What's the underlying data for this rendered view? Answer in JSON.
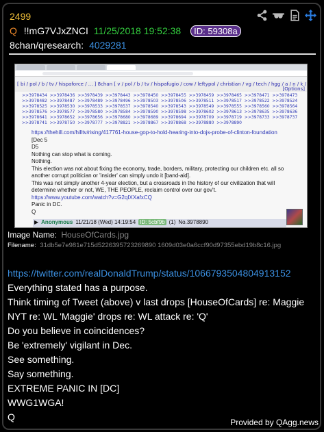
{
  "post": {
    "number": "2499",
    "q_mark": "Q",
    "tripcode": "!!mG7VJxZNCI",
    "datetime": "11/25/2018 19:52:38",
    "id_badge": "ID: 59308a",
    "board_label": "8chan/qresearch:",
    "board_link": "4029281"
  },
  "actions": {
    "icons": [
      "share-icon",
      "glasses-icon",
      "document-icon",
      "move-icon"
    ]
  },
  "screenshot": {
    "nav_line1": "[ bi / pol / b / tv / hispaforce / ... ] 8chan [ v / pol / b / tv / hispafugio / cow / leftypol / christian / vg / tech / hgg / a / n / k / fk / arepa / leftpol / tg / co / animu / brit / asmr / vichan / newsplus / egy ] [ watchlist ]",
    "nav_options": "[Options]",
    "link_rows": [
      [
        ">>3978434",
        ">>3978436",
        ">>3978439",
        ">>3978443",
        ">>3978450",
        ">>3978455",
        ">>3978459",
        ">>3978465",
        ">>3978471",
        ">>3978473"
      ],
      [
        ">>3978482",
        ">>3978487",
        ">>3978489",
        ">>3978496",
        ">>3978503",
        ">>3978506",
        ">>3978511",
        ">>3978517",
        ">>3978522",
        ">>3978524"
      ],
      [
        ">>3978525",
        ">>3978530",
        ">>3978533",
        ">>3978537",
        ">>3978540",
        ">>3978543",
        ">>3978549",
        ">>3978555",
        ">>3978560",
        ">>3978564"
      ],
      [
        ">>3978576",
        ">>3978577",
        ">>3978580",
        ">>3978584",
        ">>3978590",
        ">>3978598",
        ">>3978602",
        ">>3978613",
        ">>3978635",
        ">>3978636"
      ],
      [
        ">>3978641",
        ">>3978652",
        ">>3978656",
        ">>3978680",
        ">>3978689",
        ">>3978694",
        ">>3978709",
        ">>3978719",
        ">>3978733",
        ">>3978737"
      ],
      [
        ">>3978741",
        ">>3978750",
        ">>3978777",
        ">>3978821",
        ">>3978867",
        ">>3978868",
        ">>3978880",
        ">>3978890",
        "",
        ""
      ]
    ],
    "text_lines": [
      "https://thehill.com/hilltv/rising/417761-house-gop-to-hold-hearing-into-dojs-probe-of-clinton-foundation",
      "[Dec 5",
      "D5",
      "Nothing can stop what is coming.",
      "Nothing.",
      "This election was not about fixing the economy, trade, borders, military, protecting our children etc. all so",
      "another corrupt politician or 'insider' can simply undo it [band-aid].",
      "This was not simply another 4-year election, but a crossroads in the history of our civilization that will",
      "determine whether or not, WE, THE PEOPLE, reclaim control over our gov't.",
      "https://www.youtube.com/watch?v=G2qIXXafxCQ",
      "Panic in DC.",
      "Q"
    ],
    "footer_name": "Anonymous",
    "footer_date": "11/21/18 (Wed) 14:19:54",
    "footer_id": "ID: 5cbf9b",
    "footer_count": "(1)",
    "footer_no": "No.3978890"
  },
  "image": {
    "name_label": "Image Name:",
    "name_value": "HouseOfCards.jpg",
    "file_label": "Filename:",
    "file_value": "31db5e7e981e715d5226395723269890 1609d03e0a6ccf90d97355ebd19b8c16.jpg"
  },
  "body": {
    "tweet_link": "https://twitter.com/realDonaldTrump/status/1066793504804913152",
    "lines": [
      "Everything stated has a purpose.",
      "Think timing of Tweet (above) v last drops [HouseOfCards] re: Maggie",
      "NYT re: WL 'Maggie' drops re: WL attack re: 'Q'",
      "Do you believe in coincidences?",
      "Be 'extremely' vigilant in Dec.",
      "See something.",
      "Say something.",
      "EXTREME PANIC IN [DC]",
      "WWG1WGA!",
      "Q"
    ]
  },
  "credit": "Provided by QAgg.news",
  "colors": {
    "post_number": "#f3c13a",
    "date": "#34d03f",
    "link": "#3b8fe0",
    "badge": "#5a2f8a",
    "q_mark": "#f08a2a"
  }
}
